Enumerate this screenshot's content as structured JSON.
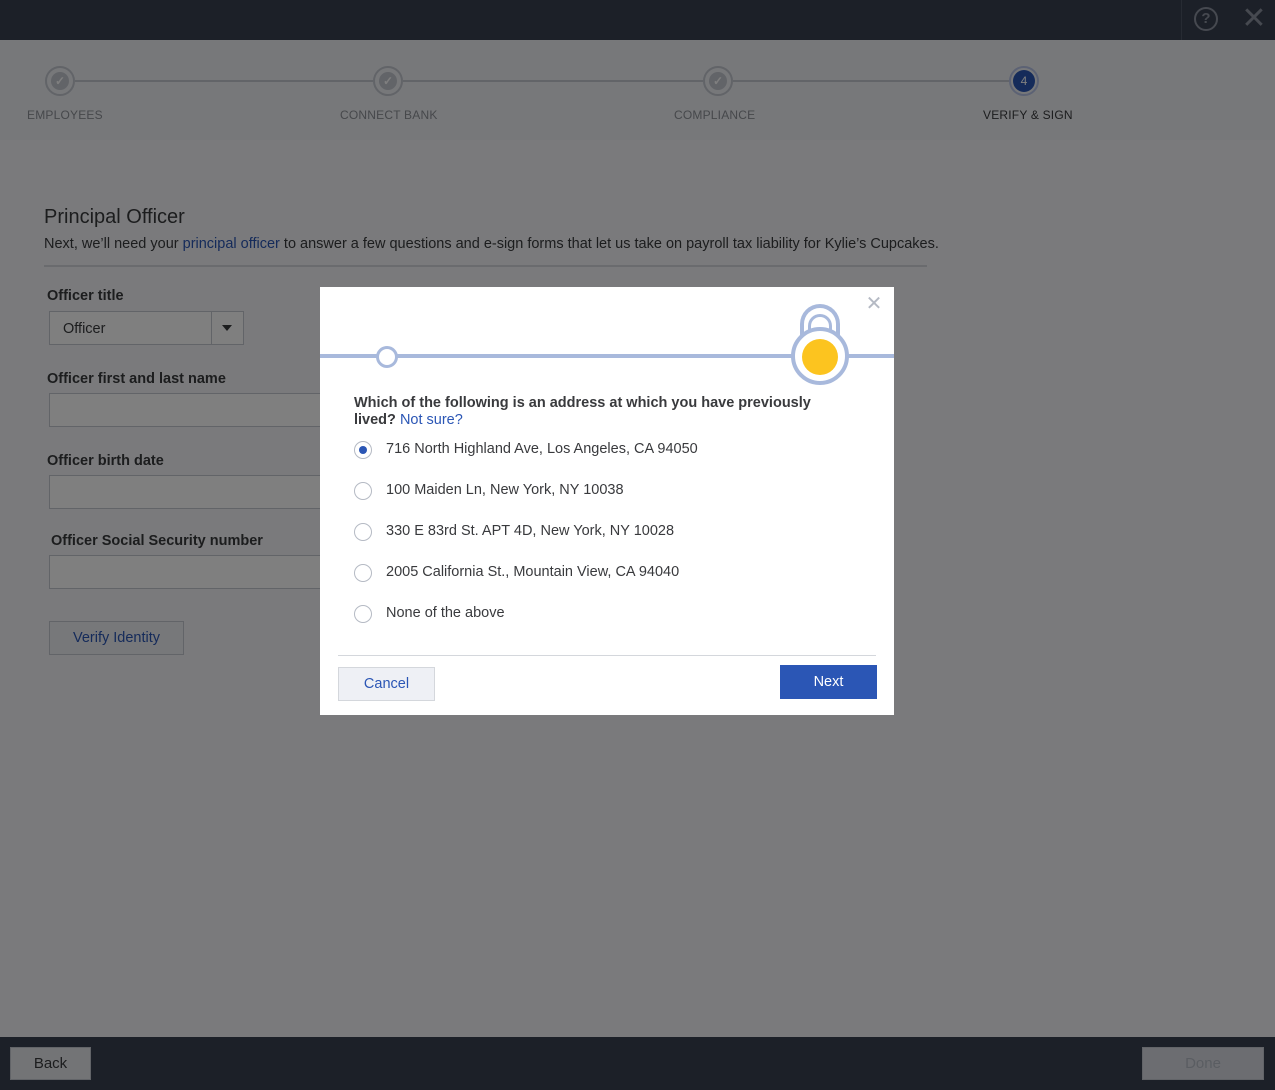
{
  "topbar": {
    "help_icon": "?",
    "close_icon": "✕"
  },
  "stepper": {
    "steps": [
      {
        "label": "EMPLOYEES",
        "status": "complete"
      },
      {
        "label": "CONNECT BANK",
        "status": "complete"
      },
      {
        "label": "COMPLIANCE",
        "status": "complete"
      },
      {
        "label": "VERIFY & SIGN",
        "status": "active",
        "number": "4"
      }
    ]
  },
  "page": {
    "title": "Principal Officer",
    "desc_before": "Next, we’ll need your ",
    "desc_link": "principal officer",
    "desc_after": " to answer a few questions and e-sign forms that let us take on payroll tax liability for Kylie’s Cupcakes."
  },
  "form": {
    "officer_title_label": "Officer title",
    "officer_title_value": "Officer",
    "name_label": "Officer first and last name",
    "name_value": "",
    "birth_label": "Officer birth date",
    "birth_value": "",
    "ssn_label": "Officer Social Security number",
    "ssn_value": "",
    "verify_label": "Verify Identity"
  },
  "footer": {
    "back_label": "Back",
    "done_label": "Done"
  },
  "modal": {
    "close_icon": "✕",
    "question": "Which of the following is an address at which you have previously lived?",
    "not_sure": "Not sure?",
    "options": [
      {
        "label": "716 North Highland Ave, Los Angeles, CA 94050",
        "selected": true
      },
      {
        "label": "100 Maiden Ln, New York, NY 10038",
        "selected": false
      },
      {
        "label": "330 E 83rd St. APT 4D, New York, NY 10028",
        "selected": false
      },
      {
        "label": "2005 California St., Mountain View, CA 94040",
        "selected": false
      },
      {
        "label": "None of the above",
        "selected": false
      }
    ],
    "cancel_label": "Cancel",
    "next_label": "Next"
  },
  "colors": {
    "accent": "#2b56b5",
    "lock_core": "#fcc41f",
    "topbar": "#394150"
  }
}
